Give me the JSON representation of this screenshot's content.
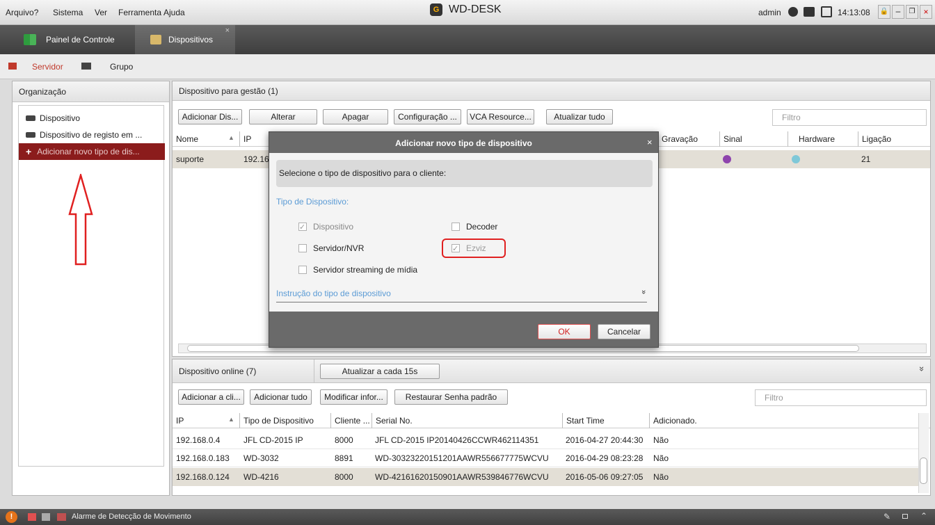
{
  "menu": {
    "items": [
      "Arquivo?",
      "Sistema",
      "Ver",
      "Ferramenta",
      "Ajuda"
    ]
  },
  "app": {
    "title": "WD-DESK",
    "user": "admin",
    "time": "14:13:08",
    "logo_glyph": "G"
  },
  "main_tabs": [
    {
      "label": "Painel de Controle"
    },
    {
      "label": "Dispositivos",
      "close": "×"
    }
  ],
  "sub_tabs": [
    {
      "label": "Servidor",
      "color": "#c0392b"
    },
    {
      "label": "Grupo"
    }
  ],
  "org": {
    "header": "Organização",
    "items": [
      "Dispositivo",
      "Dispositivo de registo em ...",
      "Adicionar novo tipo de dis..."
    ]
  },
  "mgmt": {
    "header": "Dispositivo para gestão (1)",
    "buttons": [
      "Adicionar Dis...",
      "Alterar",
      "Apagar",
      "Configuração ...",
      "VCA Resource...",
      "Atualizar tudo"
    ],
    "filter_placeholder": "Filtro",
    "columns": [
      "Nome",
      "IP",
      "Gravação",
      "Sinal",
      "Hardware",
      "Ligação"
    ],
    "row": {
      "nome": "suporte",
      "ip": "192.16",
      "ligacao": "21"
    }
  },
  "dialog": {
    "title": "Adicionar novo tipo de dispositivo",
    "close": "×",
    "prompt": "Selecione o tipo de dispositivo para o cliente:",
    "section": "Tipo de Dispositivo:",
    "options": [
      {
        "label": "Dispositivo",
        "checked": true
      },
      {
        "label": "Decoder",
        "checked": false
      },
      {
        "label": "Servidor/NVR",
        "checked": false
      },
      {
        "label": "Ezviz",
        "checked": true
      },
      {
        "label": "Servidor streaming de mídia",
        "checked": false
      }
    ],
    "instruction": "Instrução do tipo de dispositivo",
    "expand": "»",
    "ok": "OK",
    "cancel": "Cancelar"
  },
  "online": {
    "header": "Dispositivo online (7)",
    "refresh": "Atualizar a cada 15s",
    "buttons": [
      "Adicionar a cli...",
      "Adicionar tudo",
      "Modificar infor...",
      "Restaurar Senha padrão"
    ],
    "filter_placeholder": "Filtro",
    "columns": [
      "IP",
      "Tipo de Dispositivo",
      "Cliente ...",
      "Serial No.",
      "Start Time",
      "Adicionado."
    ],
    "rows": [
      {
        "ip": "192.168.0.4",
        "tipo": "JFL CD-2015 IP",
        "cliente": "8000",
        "serial": "JFL CD-2015 IP20140426CCWR462114351",
        "start": "2016-04-27 20:44:30",
        "adicionado": "Não"
      },
      {
        "ip": "192.168.0.183",
        "tipo": "WD-3032",
        "cliente": "8891",
        "serial": "WD-30323220151201AAWR556677775WCVU",
        "start": "2016-04-29 08:23:28",
        "adicionado": "Não"
      },
      {
        "ip": "192.168.0.124",
        "tipo": "WD-4216",
        "cliente": "8000",
        "serial": "WD-42161620150901AAWR539846776WCVU",
        "start": "2016-05-06 09:27:05",
        "adicionado": "Não"
      }
    ]
  },
  "status": {
    "alarm": "Alarme de Detecção de Movimento"
  },
  "colors": {
    "accent_red": "#e02020",
    "selection": "#8b1c1c",
    "link_blue": "#5b9bd5"
  }
}
